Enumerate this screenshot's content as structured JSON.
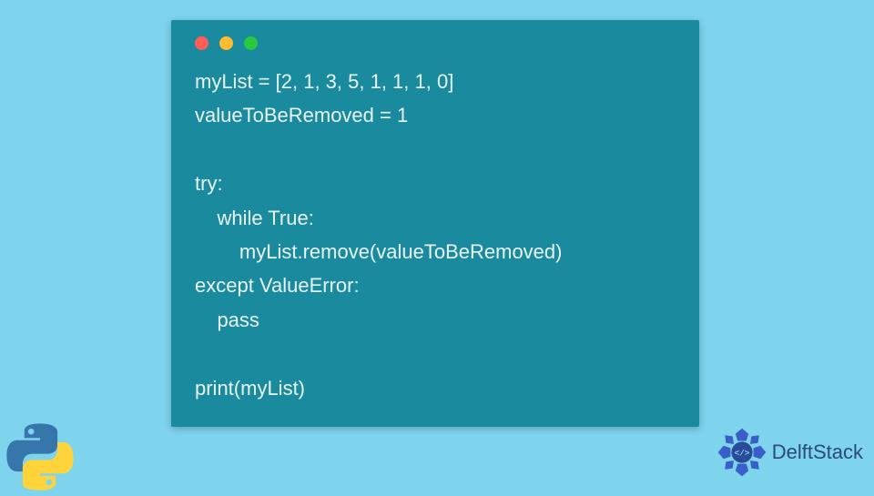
{
  "code": {
    "lines": [
      "myList = [2, 1, 3, 5, 1, 1, 1, 0]",
      "valueToBeRemoved = 1",
      "",
      "try:",
      "    while True:",
      "        myList.remove(valueToBeRemoved)",
      "except ValueError:",
      "    pass",
      "",
      "print(myList)"
    ]
  },
  "brand": {
    "name": "DelftStack"
  },
  "icons": {
    "python": "python-logo",
    "delft": "delft-logo"
  }
}
